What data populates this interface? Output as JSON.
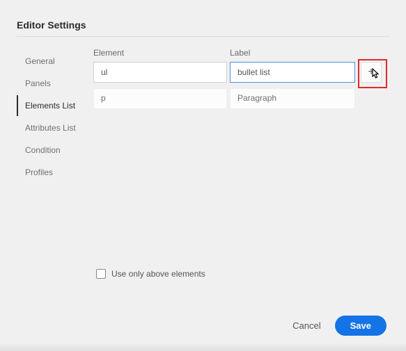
{
  "title": "Editor Settings",
  "sidebar": {
    "items": [
      {
        "label": "General"
      },
      {
        "label": "Panels"
      },
      {
        "label": "Elements List"
      },
      {
        "label": "Attributes List"
      },
      {
        "label": "Condition"
      },
      {
        "label": "Profiles"
      }
    ]
  },
  "headers": {
    "element": "Element",
    "label": "Label"
  },
  "rows": [
    {
      "element": "ul",
      "label": "bullet list"
    },
    {
      "element": "p",
      "label": "Paragraph"
    }
  ],
  "add_icon": "+",
  "checkbox": {
    "label": "Use only above elements"
  },
  "footer": {
    "cancel": "Cancel",
    "save": "Save"
  }
}
